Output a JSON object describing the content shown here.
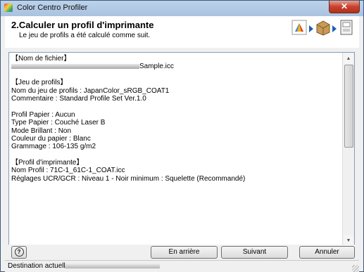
{
  "window": {
    "title": "Color Centro Profiler",
    "close_label": "✕"
  },
  "header": {
    "title": "2.Calculer un profil d'imprimante",
    "subtitle": "Le jeu de profils a été calculé comme suit.",
    "step_icons": [
      "color-wheel-icon",
      "box-icon",
      "printer-icon"
    ]
  },
  "content": {
    "lines": [
      "【Nom de fichier】",
      "Sample.icc",
      "",
      "【Jeu de profils】",
      "Nom du jeu de profils : JapanColor_sRGB_COAT1",
      "Commentaire : Standard Profile Set Ver.1.0",
      "",
      "Profil Papier : Aucun",
      "Type Papier : Couché Laser B",
      "Mode Brillant : Non",
      "Couleur du papier : Blanc",
      "Grammage : 106-135 g/m2",
      "",
      "【Profil d'imprimante】",
      "Nom Profil : 71C-1_61C-1_COAT.icc",
      "Réglages UCR/GCR : Niveau 1 - Noir minimum : Squelette (Recommandé)"
    ]
  },
  "buttons": {
    "help": "?",
    "back": "En arrière",
    "next": "Suivant",
    "cancel": "Annuler"
  },
  "status": {
    "label": "Destination actuelle"
  },
  "colors": {
    "accent": "#1b5fb8",
    "close": "#c7422d"
  }
}
